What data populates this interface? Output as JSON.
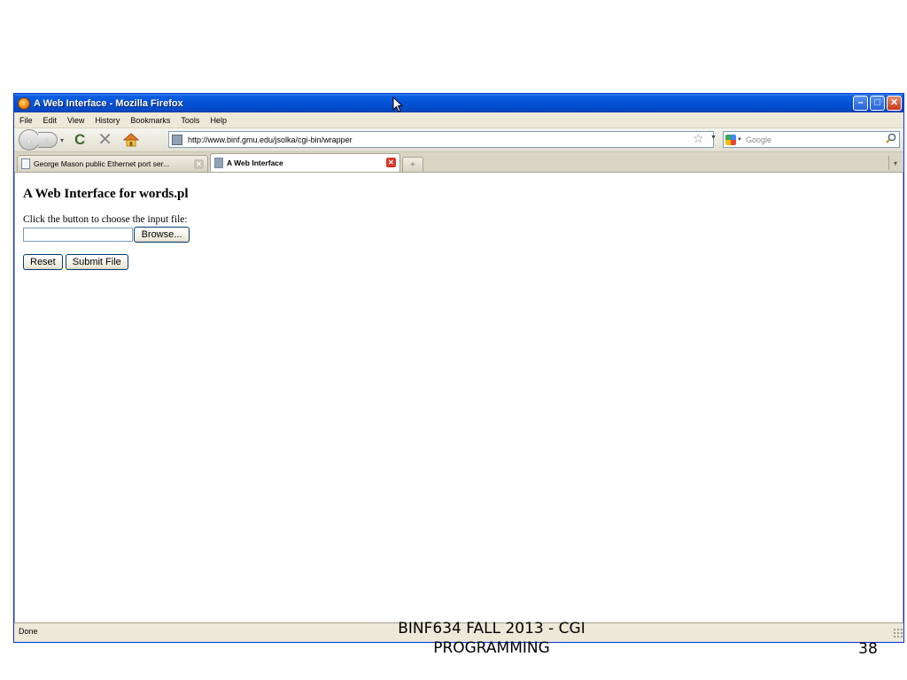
{
  "window": {
    "title": "A Web Interface - Mozilla Firefox",
    "minimize": "–",
    "maximize": "□",
    "close": "✕"
  },
  "menu": {
    "items": [
      "File",
      "Edit",
      "View",
      "History",
      "Bookmarks",
      "Tools",
      "Help"
    ]
  },
  "navbar": {
    "url": "http://www.binf.gmu.edu/jsolka/cgi-bin/wrapper",
    "search_placeholder": "Google"
  },
  "tabs": [
    {
      "label": "George Mason public Ethernet port ser...",
      "active": false
    },
    {
      "label": "A Web Interface",
      "active": true
    }
  ],
  "page": {
    "heading": "A Web Interface for words.pl",
    "instruction": "Click the button to choose the input file:",
    "browse_label": "Browse...",
    "reset_label": "Reset",
    "submit_label": "Submit File"
  },
  "status": {
    "text": "Done"
  },
  "slide": {
    "footer_line1": "BINF634 FALL 2013 - CGI",
    "footer_line2": "PROGRAMMING",
    "number": "38"
  },
  "icons": {
    "firefox": "firefox-icon",
    "back": "back-arrow-icon",
    "forward": "forward-arrow-icon",
    "reload": "reload-icon",
    "stop": "stop-icon",
    "home": "home-icon",
    "bookmark_star": "star-icon",
    "search": "magnifier-icon"
  }
}
